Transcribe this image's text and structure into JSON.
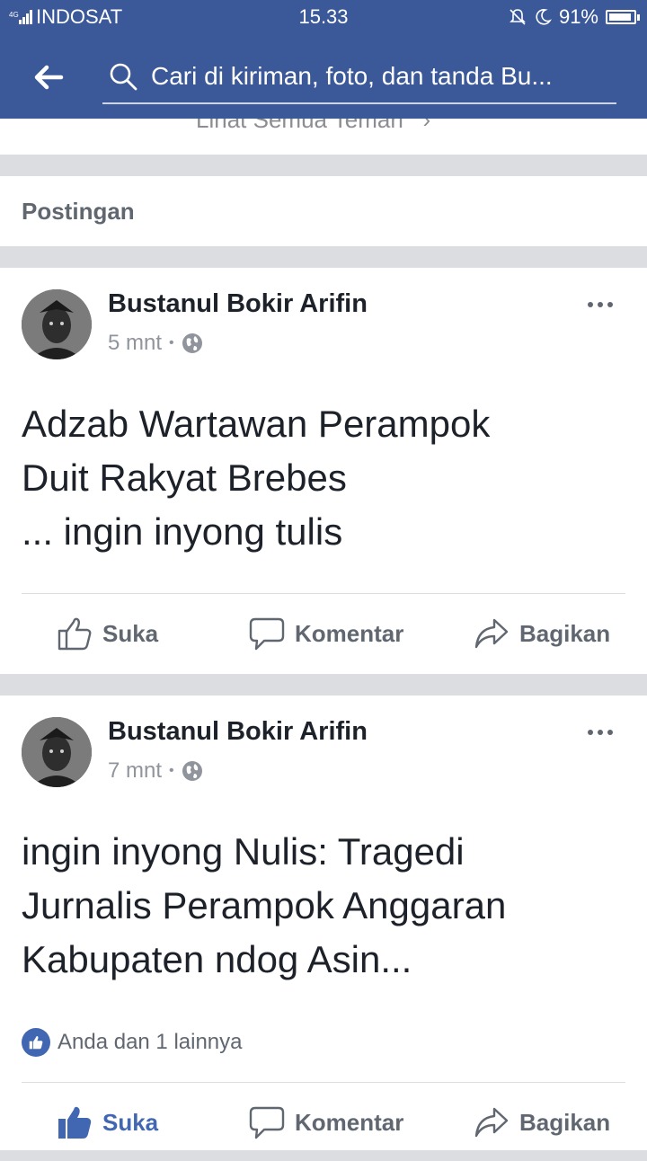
{
  "status_bar": {
    "carrier": "INDOSAT",
    "time": "15.33",
    "battery": "91%",
    "battery_level": 0.91
  },
  "search": {
    "placeholder": "Cari di kiriman, foto, dan tanda Bu..."
  },
  "friends": {
    "see_all_label": "Lihat Semua Teman"
  },
  "section": {
    "title": "Postingan"
  },
  "posts": [
    {
      "author": "Bustanul Bokir Arifin",
      "time": "5 mnt",
      "separator": "•",
      "text_lines": [
        "Adzab Wartawan Perampok",
        "Duit Rakyat Brebes",
        "... ingin inyong tulis"
      ],
      "reactions_text": "",
      "liked": false,
      "actions": {
        "like": "Suka",
        "comment": "Komentar",
        "share": "Bagikan"
      }
    },
    {
      "author": "Bustanul Bokir Arifin",
      "time": "7 mnt",
      "separator": "•",
      "text_lines": [
        "ingin inyong Nulis: Tragedi",
        "Jurnalis Perampok Anggaran",
        "Kabupaten ndog Asin..."
      ],
      "reactions_text": "Anda dan 1 lainnya",
      "liked": true,
      "actions": {
        "like": "Suka",
        "comment": "Komentar",
        "share": "Bagikan"
      }
    }
  ],
  "colors": {
    "brand": "#3b5998",
    "like_blue": "#4267b2"
  }
}
